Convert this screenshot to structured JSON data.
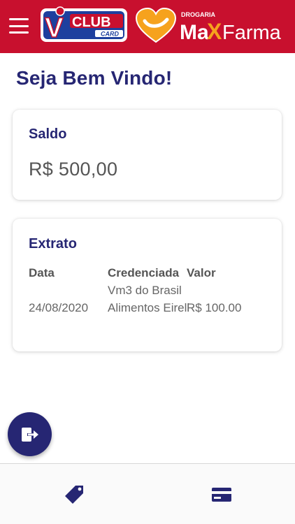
{
  "header": {
    "bg_color": "#c8102e",
    "logo_vclub": {
      "v": "V",
      "club": "CLUB",
      "card": "CARD"
    },
    "logo_maxfarma": {
      "drogaria": "DROGARIA",
      "max": "MaX",
      "farma": "Farma"
    }
  },
  "main": {
    "title": "Seja Bem Vindo!",
    "saldo": {
      "title": "Saldo",
      "value": "R$ 500,00"
    },
    "extrato": {
      "title": "Extrato",
      "columns": [
        "Data",
        "Credenciada",
        "Valor"
      ],
      "rows": [
        {
          "data": "24/08/2020",
          "credenciada": "Vm3 do Brasil Alimentos Eireli",
          "valor": "R$ 100.00"
        }
      ]
    }
  },
  "fab": {
    "icon": "logout-icon"
  },
  "bottom_nav": [
    {
      "icon": "tag-icon"
    },
    {
      "icon": "credit-card-icon"
    }
  ],
  "colors": {
    "primary": "#262673",
    "accent": "#c8102e"
  }
}
